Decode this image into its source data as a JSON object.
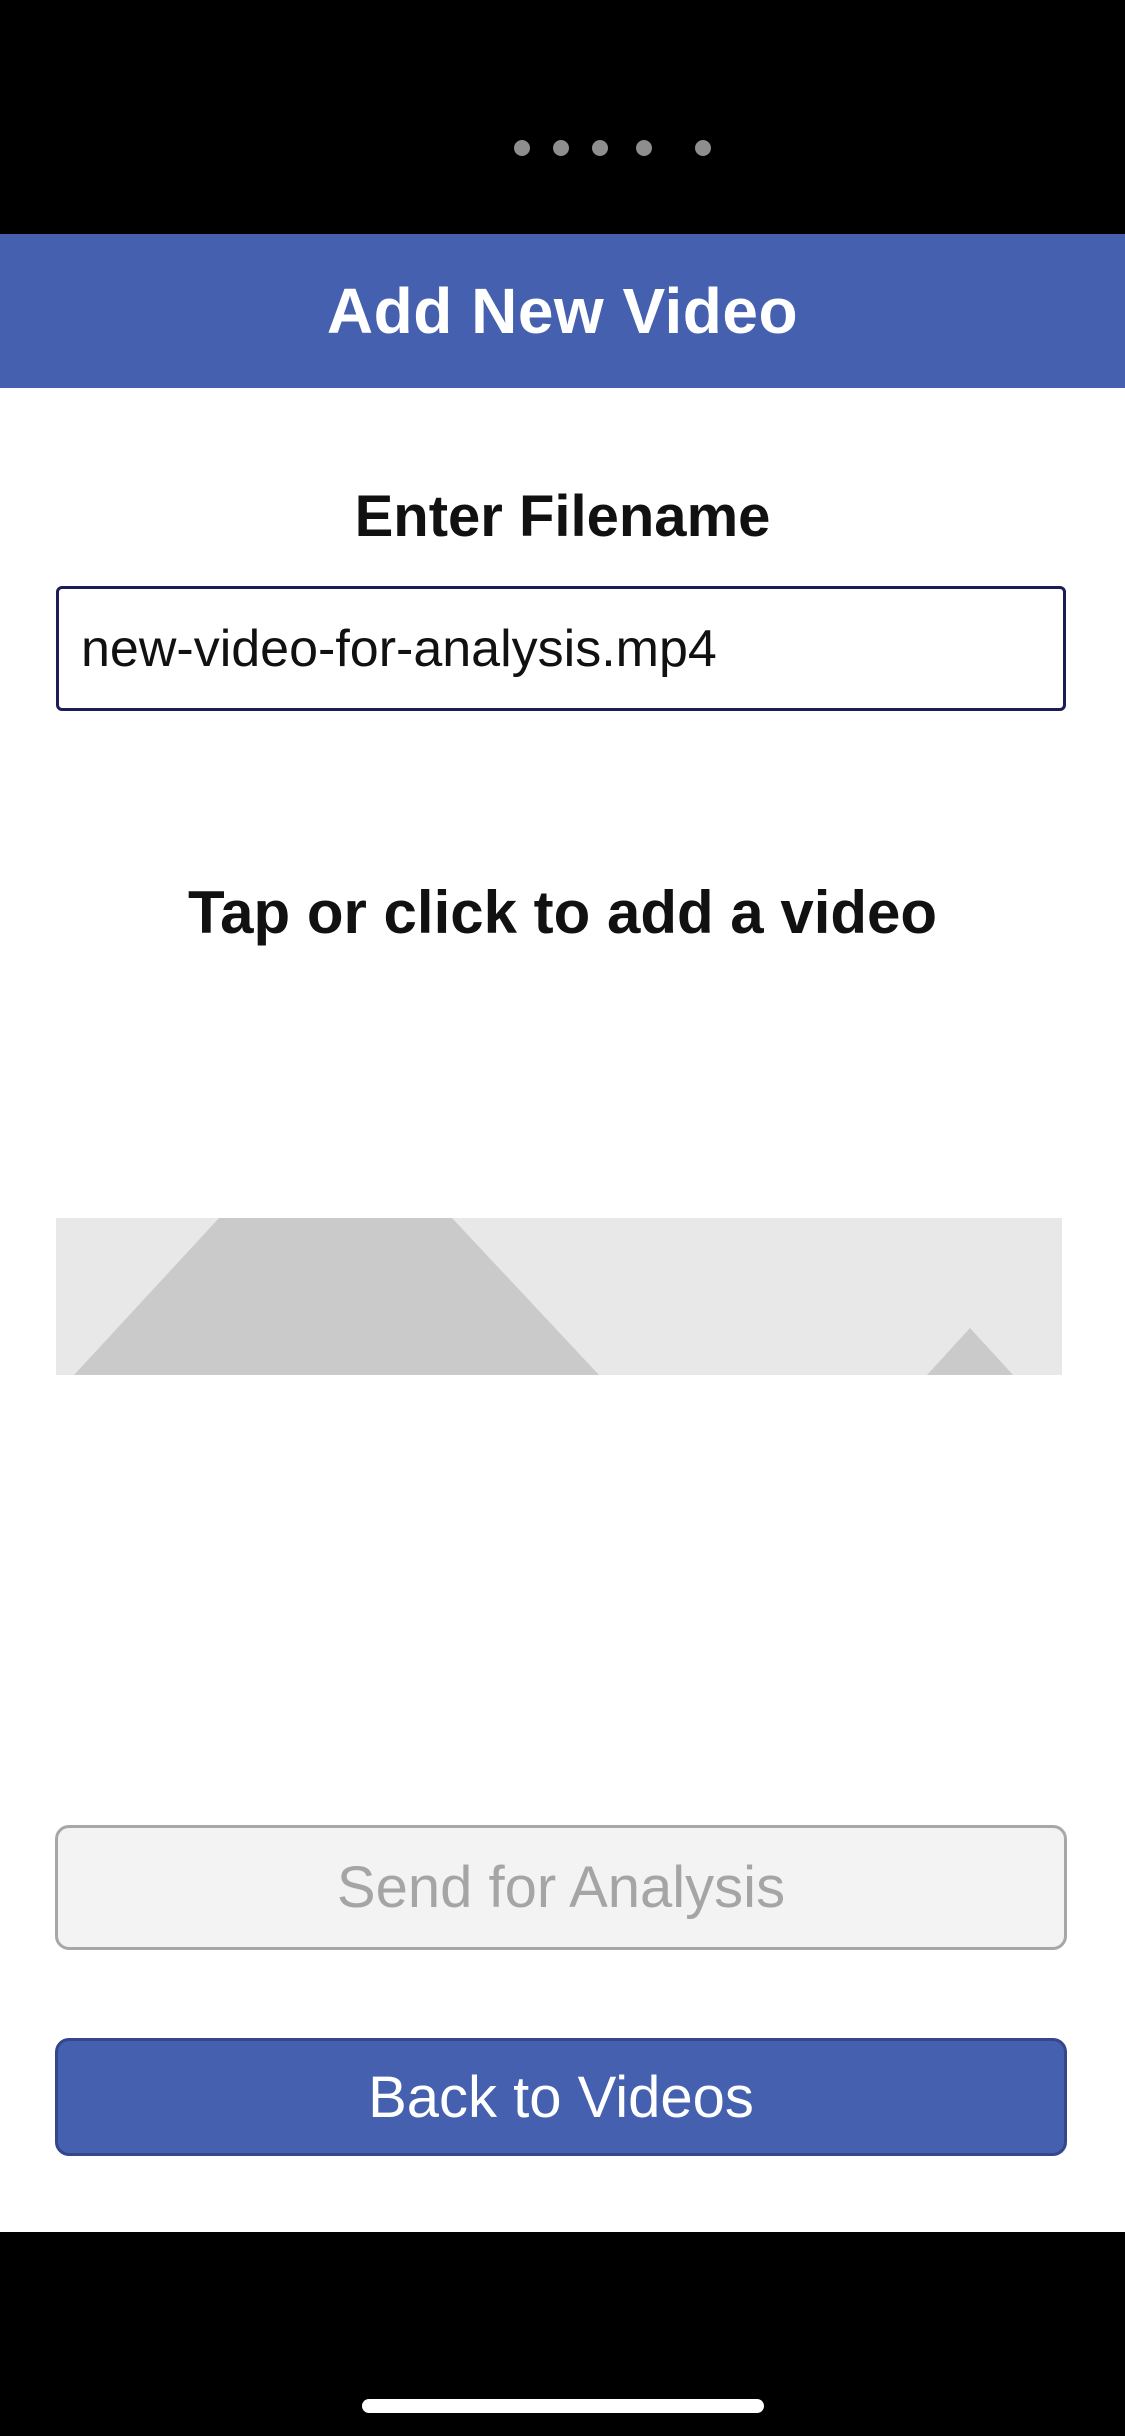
{
  "header": {
    "title": "Add New Video",
    "background_color": "#4460ae"
  },
  "status_bar": {
    "page_dots_count": 5
  },
  "filename_section": {
    "label": "Enter Filename",
    "input_value": "new-video-for-analysis.mp4",
    "border_color": "#1c1c58"
  },
  "video_section": {
    "label": "Tap or click to add a video",
    "placeholder_icon": "image-placeholder-icon"
  },
  "buttons": {
    "send_label": "Send for Analysis",
    "send_state": "disabled",
    "back_label": "Back to Videos",
    "back_color": "#4460ae"
  }
}
